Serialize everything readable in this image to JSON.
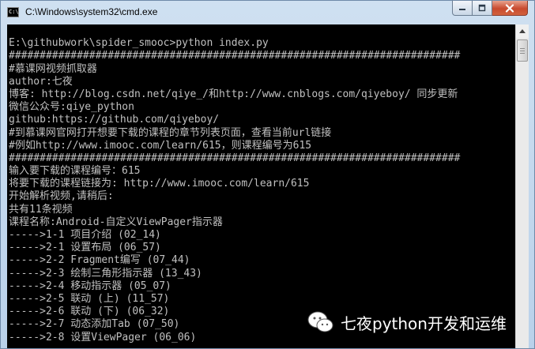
{
  "window": {
    "title": "C:\\Windows\\system32\\cmd.exe",
    "icon": "cmd-icon",
    "controls": [
      "minimize-icon",
      "maximize-icon",
      "close-icon"
    ]
  },
  "console": {
    "lines": [
      "",
      "E:\\githubwork\\spider_smooc>python index.py",
      "#########################################################################",
      "#慕课网视频抓取器",
      "author:七夜",
      "博客: http://blog.csdn.net/qiye_/和http://www.cnblogs.com/qiyeboy/ 同步更新",
      "微信公众号:qiye_python",
      "github:https://github.com/qiyeboy/",
      "#到慕课网官网打开想要下载的课程的章节列表页面，查看当前url链接",
      "#例如http://www.imooc.com/learn/615，则课程编号为615",
      "#########################################################################",
      "输入要下载的课程编号：615",
      "将要下载的课程链接为: http://www.imooc.com/learn/615",
      "开始解析视频,请稍后:",
      "共有11条视频",
      "课程名称:Android-自定义ViewPager指示器",
      "----->1-1 项目介绍 (02_14)",
      "----->2-1 设置布局 (06_57)",
      "----->2-2 Fragment编写 (07_44)",
      "----->2-3 绘制三角形指示器 (13_43)",
      "----->2-4 移动指示器 (05_07)",
      "----->2-5 联动 (上) (11_57)",
      "----->2-6 联动 (下) (06_32)",
      "----->2-7 动态添加Tab (07_50)",
      "----->2-8 设置ViewPager (06_06)"
    ]
  },
  "watermark": {
    "icon": "wechat-icon",
    "text": "七夜python开发和运维"
  },
  "colors": {
    "console_bg": "#000000",
    "console_fg": "#c0c0c0",
    "titlebar": "#c4d8ee",
    "close_button": "#c84a2e"
  }
}
